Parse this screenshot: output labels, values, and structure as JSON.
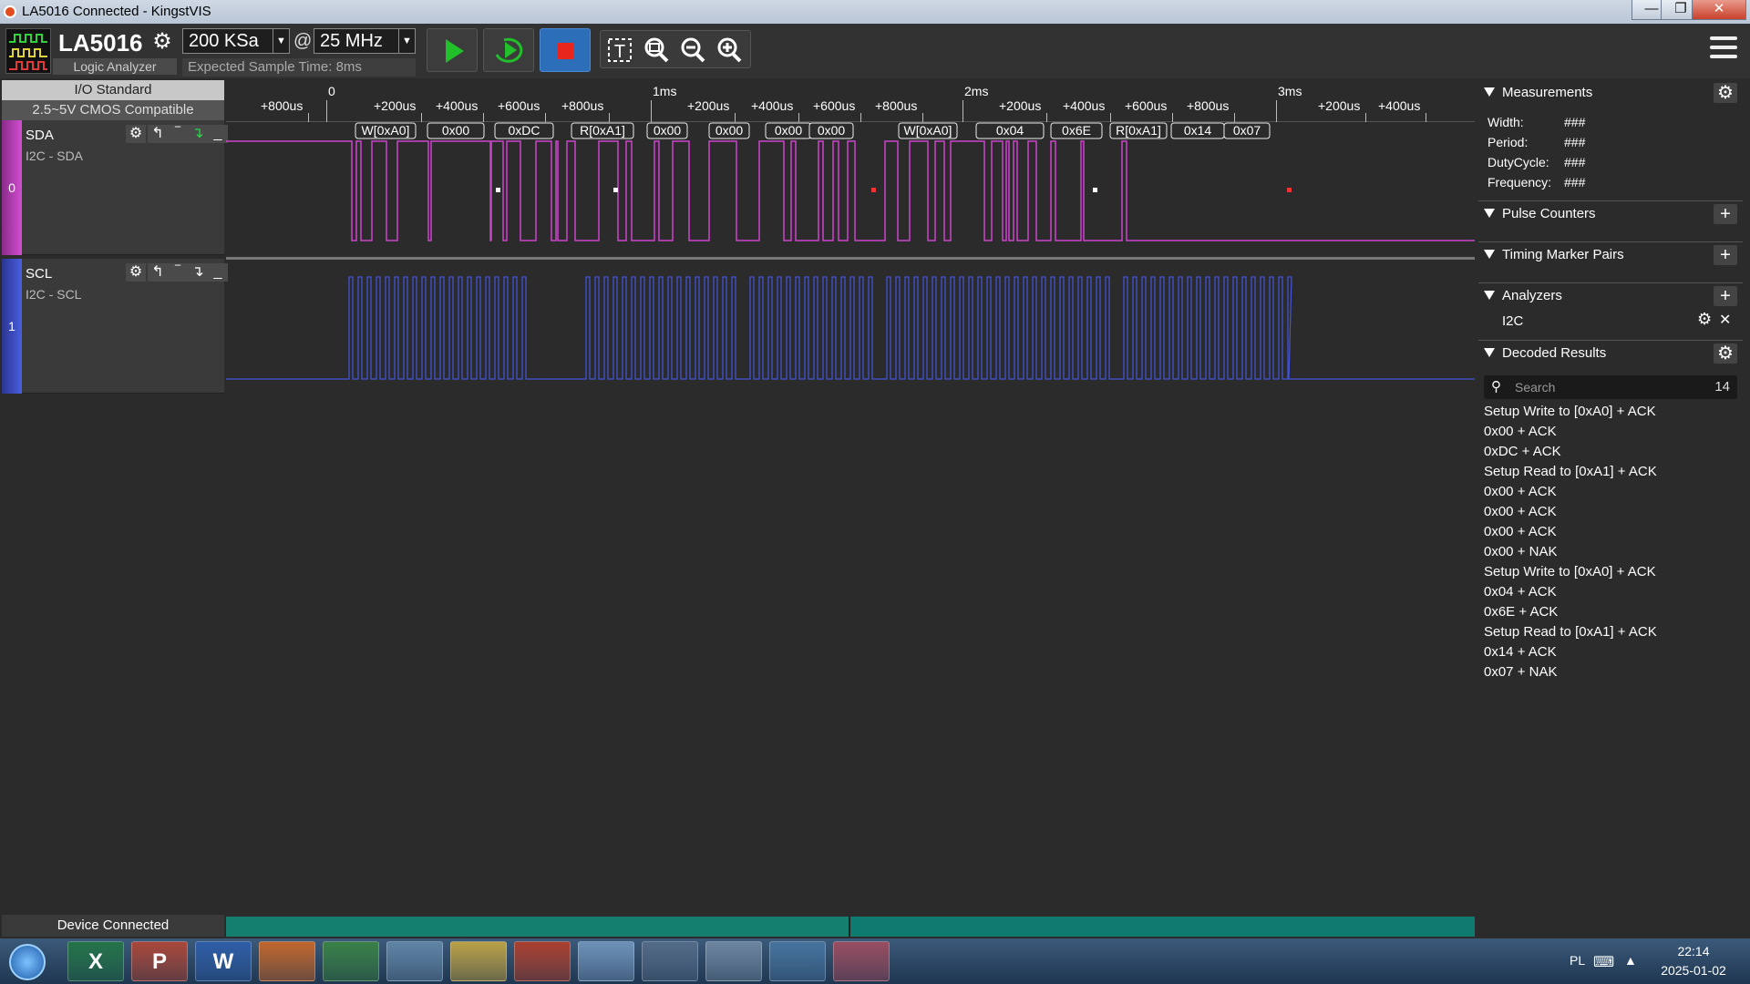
{
  "window": {
    "title": "LA5016 Connected - KingstVIS"
  },
  "toolbar": {
    "device_name": "LA5016",
    "device_subtitle": "Logic Analyzer",
    "sample_depth": "200 KSa",
    "at_symbol": "@",
    "sample_rate": "25 MHz",
    "expected_sample_time": "Expected Sample Time: 8ms"
  },
  "io_standard": {
    "header": "I/O Standard",
    "value": "2.5~5V CMOS Compatible"
  },
  "channels": [
    {
      "index": "0",
      "name": "SDA",
      "analyzer_label": "I2C - SDA",
      "color": "#cc44cc"
    },
    {
      "index": "1",
      "name": "SCL",
      "analyzer_label": "I2C - SCL",
      "color": "#4455dd"
    }
  ],
  "ruler": {
    "labels": [
      "+800us",
      "0",
      "+200us",
      "+400us",
      "+600us",
      "+800us",
      "1ms",
      "+200us",
      "+400us",
      "+600us",
      "+800us",
      "2ms",
      "+200us",
      "+400us",
      "+600us",
      "+800us",
      "3ms",
      "+200us",
      "+400us"
    ]
  },
  "decoded_bubbles": [
    "W[0xA0]",
    "0x00",
    "0xDC",
    "R[0xA1]",
    "0x00",
    "0x00",
    "0x00",
    "0x00",
    "W[0xA0]",
    "0x04",
    "0x6E",
    "R[0xA1]",
    "0x14",
    "0x07"
  ],
  "status": {
    "text": "Device Connected",
    "progress": 0.5
  },
  "panel": {
    "measurements_title": "Measurements",
    "measurements": [
      {
        "label": "Width:",
        "value": "###"
      },
      {
        "label": "Period:",
        "value": "###"
      },
      {
        "label": "DutyCycle:",
        "value": "###"
      },
      {
        "label": "Frequency:",
        "value": "###"
      }
    ],
    "pulse_counters_title": "Pulse Counters",
    "timing_pairs_title": "Timing Marker Pairs",
    "analyzers_title": "Analyzers",
    "analyzer_item": "I2C",
    "decoded_title": "Decoded Results",
    "search_placeholder": "Search",
    "result_count": "14",
    "results": [
      "Setup Write to [0xA0] + ACK",
      "0x00 + ACK",
      "0xDC + ACK",
      "Setup Read to [0xA1] + ACK",
      "0x00 + ACK",
      "0x00 + ACK",
      "0x00 + ACK",
      "0x00 + NAK",
      "Setup Write to [0xA0] + ACK",
      "0x04 + ACK",
      "0x6E + ACK",
      "Setup Read to [0xA1] + ACK",
      "0x14 + ACK",
      "0x07 + NAK"
    ]
  },
  "taskbar": {
    "apps": [
      "excel-icon",
      "powerpoint-icon",
      "word-icon",
      "firefox-icon",
      "network-tool-icon",
      "notes-icon",
      "file-explorer-icon",
      "kingstvis-icon",
      "paint-icon",
      "scanner-icon",
      "calculator-icon",
      "photo-viewer-icon",
      "snipping-tool-icon"
    ],
    "app_glyphs": [
      "X",
      "P",
      "W",
      "",
      "",
      "",
      "",
      "",
      "",
      "",
      "",
      "",
      ""
    ],
    "language": "PL",
    "time": "22:14",
    "date": "2025-01-02"
  }
}
